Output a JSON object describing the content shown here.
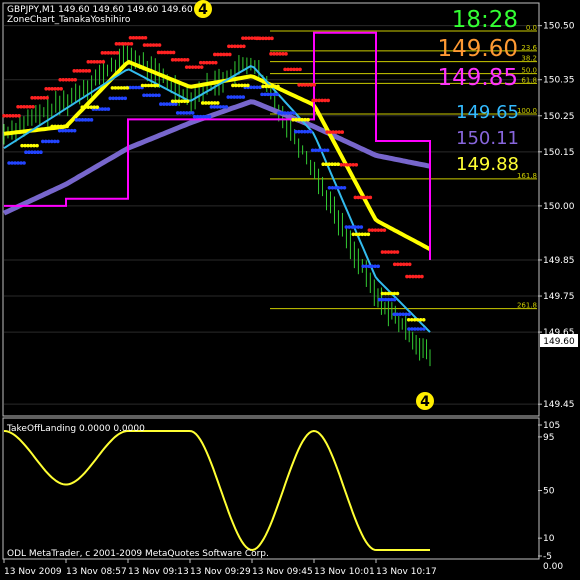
{
  "window": {
    "header_line": "GBPJPY,M1  149.60 149.60 149.60 149.60",
    "indicator_name": "ZoneChart_TanakaYoshihiro"
  },
  "readouts": [
    {
      "key": "clock",
      "text": "18:28",
      "color": "#33ff33"
    },
    {
      "key": "price1",
      "text": "149.60",
      "color": "#ff9933"
    },
    {
      "key": "price2",
      "text": "149.85",
      "color": "#ff33ff"
    },
    {
      "key": "price3",
      "text": "149.65",
      "color": "#33bbff"
    },
    {
      "key": "price4",
      "text": "150.11",
      "color": "#8866dd"
    },
    {
      "key": "price5",
      "text": "149.88",
      "color": "#ffff33"
    }
  ],
  "fib_levels": [
    {
      "label": "0.0",
      "price": 150.485
    },
    {
      "label": "23.6",
      "price": 150.43
    },
    {
      "label": "38.2",
      "price": 150.4
    },
    {
      "label": "50.0",
      "price": 150.367
    },
    {
      "label": "61.8",
      "price": 150.34
    },
    {
      "label": "100.0",
      "price": 150.255
    },
    {
      "label": "161.8",
      "price": 150.075
    },
    {
      "label": "261.8",
      "price": 149.715
    }
  ],
  "price_axis": {
    "ticks": [
      "150.50",
      "150.35",
      "150.25",
      "150.15",
      "150.00",
      "149.85",
      "149.75",
      "149.65",
      "149.45"
    ],
    "current_price": "149.60"
  },
  "indicator_axis": {
    "title": "TakeOffLanding 0.0000 0.0000",
    "ticks": [
      "105",
      "95",
      "50",
      "10",
      "-5",
      "0.00"
    ]
  },
  "time_axis": [
    "13 Nov 2009",
    "13 Nov 08:57",
    "13 Nov 09:13",
    "13 Nov 09:29",
    "13 Nov 09:45",
    "13 Nov 10:01",
    "13 Nov 10:17"
  ],
  "markers": [
    {
      "key": "marker-top",
      "text": "4"
    },
    {
      "key": "marker-bottom",
      "text": "4"
    }
  ],
  "footer_copyright": "ODL MetaTrader, c 2001-2009 MetaQuotes Software Corp.",
  "colors": {
    "background": "#000000",
    "grid": "#2a2a2a",
    "axis": "#c0c0c0",
    "price_bars": "#33cc33",
    "fib": "#cccc00",
    "magenta": "#ff00ff",
    "yellow": "#ffff00",
    "cyan": "#33bbee",
    "purple": "#7766cc",
    "dot_red": "#ff2222",
    "dot_blue": "#2244ff",
    "dot_yellow": "#ffff00",
    "oscillator": "#ffff33",
    "oscillator_high": "#33ff33"
  },
  "chart_data": [
    {
      "type": "line",
      "symbol": "GBPJPY",
      "timeframe": "M1",
      "ylim": [
        149.42,
        150.56
      ],
      "x": [
        "08:41",
        "08:57",
        "09:13",
        "09:29",
        "09:45",
        "10:01",
        "10:17",
        "10:22"
      ],
      "series": [
        {
          "values": [
            150.2,
            150.29,
            150.42,
            150.3,
            150.4,
            150.1,
            149.75,
            149.58
          ]
        },
        {
          "values": [
            150.2,
            150.22,
            150.4,
            150.33,
            150.36,
            150.28,
            149.96,
            149.88
          ]
        },
        {
          "values": [
            150.16,
            150.27,
            150.38,
            150.29,
            150.39,
            150.2,
            149.8,
            149.65
          ]
        },
        {
          "values": [
            149.98,
            150.06,
            150.16,
            150.23,
            150.29,
            150.22,
            150.14,
            150.11
          ]
        },
        {
          "values": [
            150.0,
            150.02,
            150.24,
            150.24,
            150.24,
            150.48,
            150.18,
            149.85
          ]
        }
      ]
    },
    {
      "type": "line",
      "title": "TakeOffLanding 0.0000 0.0000",
      "ylim": [
        -5,
        105
      ],
      "x": [
        "08:41",
        "08:57",
        "09:13",
        "09:29",
        "09:45",
        "10:01",
        "10:17",
        "10:22"
      ],
      "series": [
        {
          "values": [
            100,
            55,
            100,
            100,
            0,
            100,
            0,
            0
          ]
        }
      ]
    }
  ]
}
